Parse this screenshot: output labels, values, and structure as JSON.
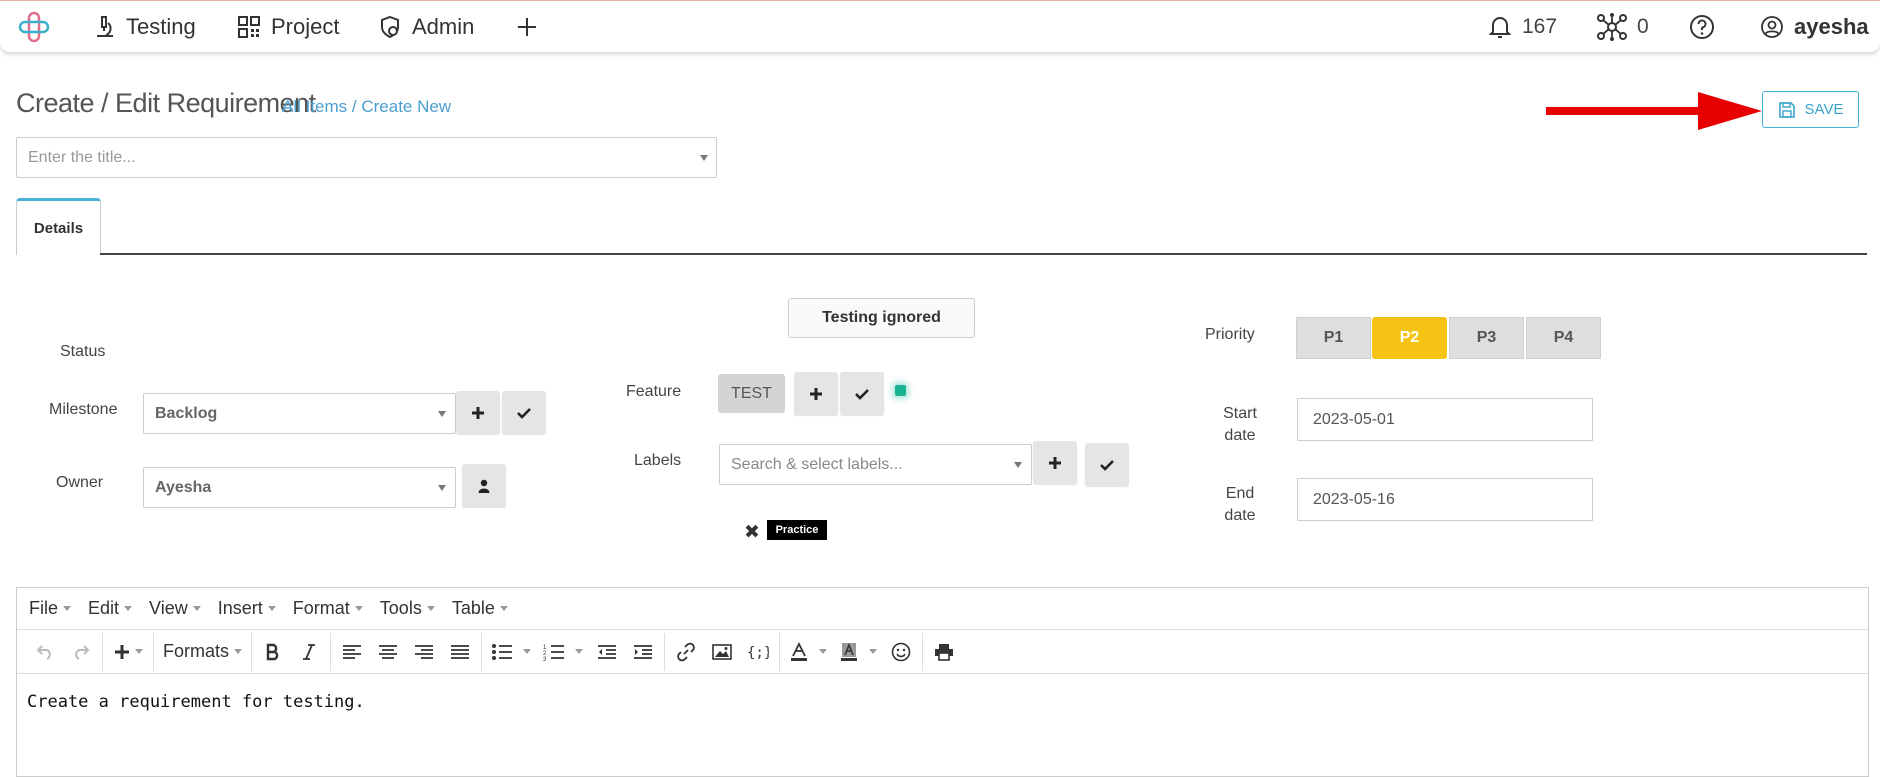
{
  "nav": {
    "items": [
      {
        "label": "Testing",
        "icon": "microscope-icon"
      },
      {
        "label": "Project",
        "icon": "qr-grid-icon"
      },
      {
        "label": "Admin",
        "icon": "shield-gear-icon"
      }
    ],
    "add_icon": "plus-icon",
    "notifications_count": "167",
    "network_count": "0",
    "username": "ayesha"
  },
  "header": {
    "title": "Create / Edit Requirement",
    "breadcrumb": "All Items / Create New",
    "title_placeholder": "Enter the title...",
    "save_label": "SAVE"
  },
  "tabs": [
    {
      "label": "Details"
    }
  ],
  "form": {
    "status_label": "Status",
    "milestone_label": "Milestone",
    "milestone_value": "Backlog",
    "owner_label": "Owner",
    "owner_value": "Ayesha",
    "testing_ignored_label": "Testing ignored",
    "feature_label": "Feature",
    "feature_chip": "TEST",
    "labels_label": "Labels",
    "labels_placeholder": "Search & select labels...",
    "label_tag": "Practice",
    "priority_label": "Priority",
    "priorities": [
      "P1",
      "P2",
      "P3",
      "P4"
    ],
    "priority_selected": "P2",
    "start_date_label": "Start date",
    "start_date_value": "2023-05-01",
    "end_date_label": "End date",
    "end_date_value": "2023-05-16"
  },
  "editor": {
    "menus": [
      "File",
      "Edit",
      "View",
      "Insert",
      "Format",
      "Tools",
      "Table"
    ],
    "formats_label": "Formats",
    "content": "Create a requirement for testing."
  },
  "colors": {
    "accent": "#47b1d8",
    "priority_active": "#f5c314",
    "arrow": "#e60000",
    "feature_dot": "#19b394"
  }
}
